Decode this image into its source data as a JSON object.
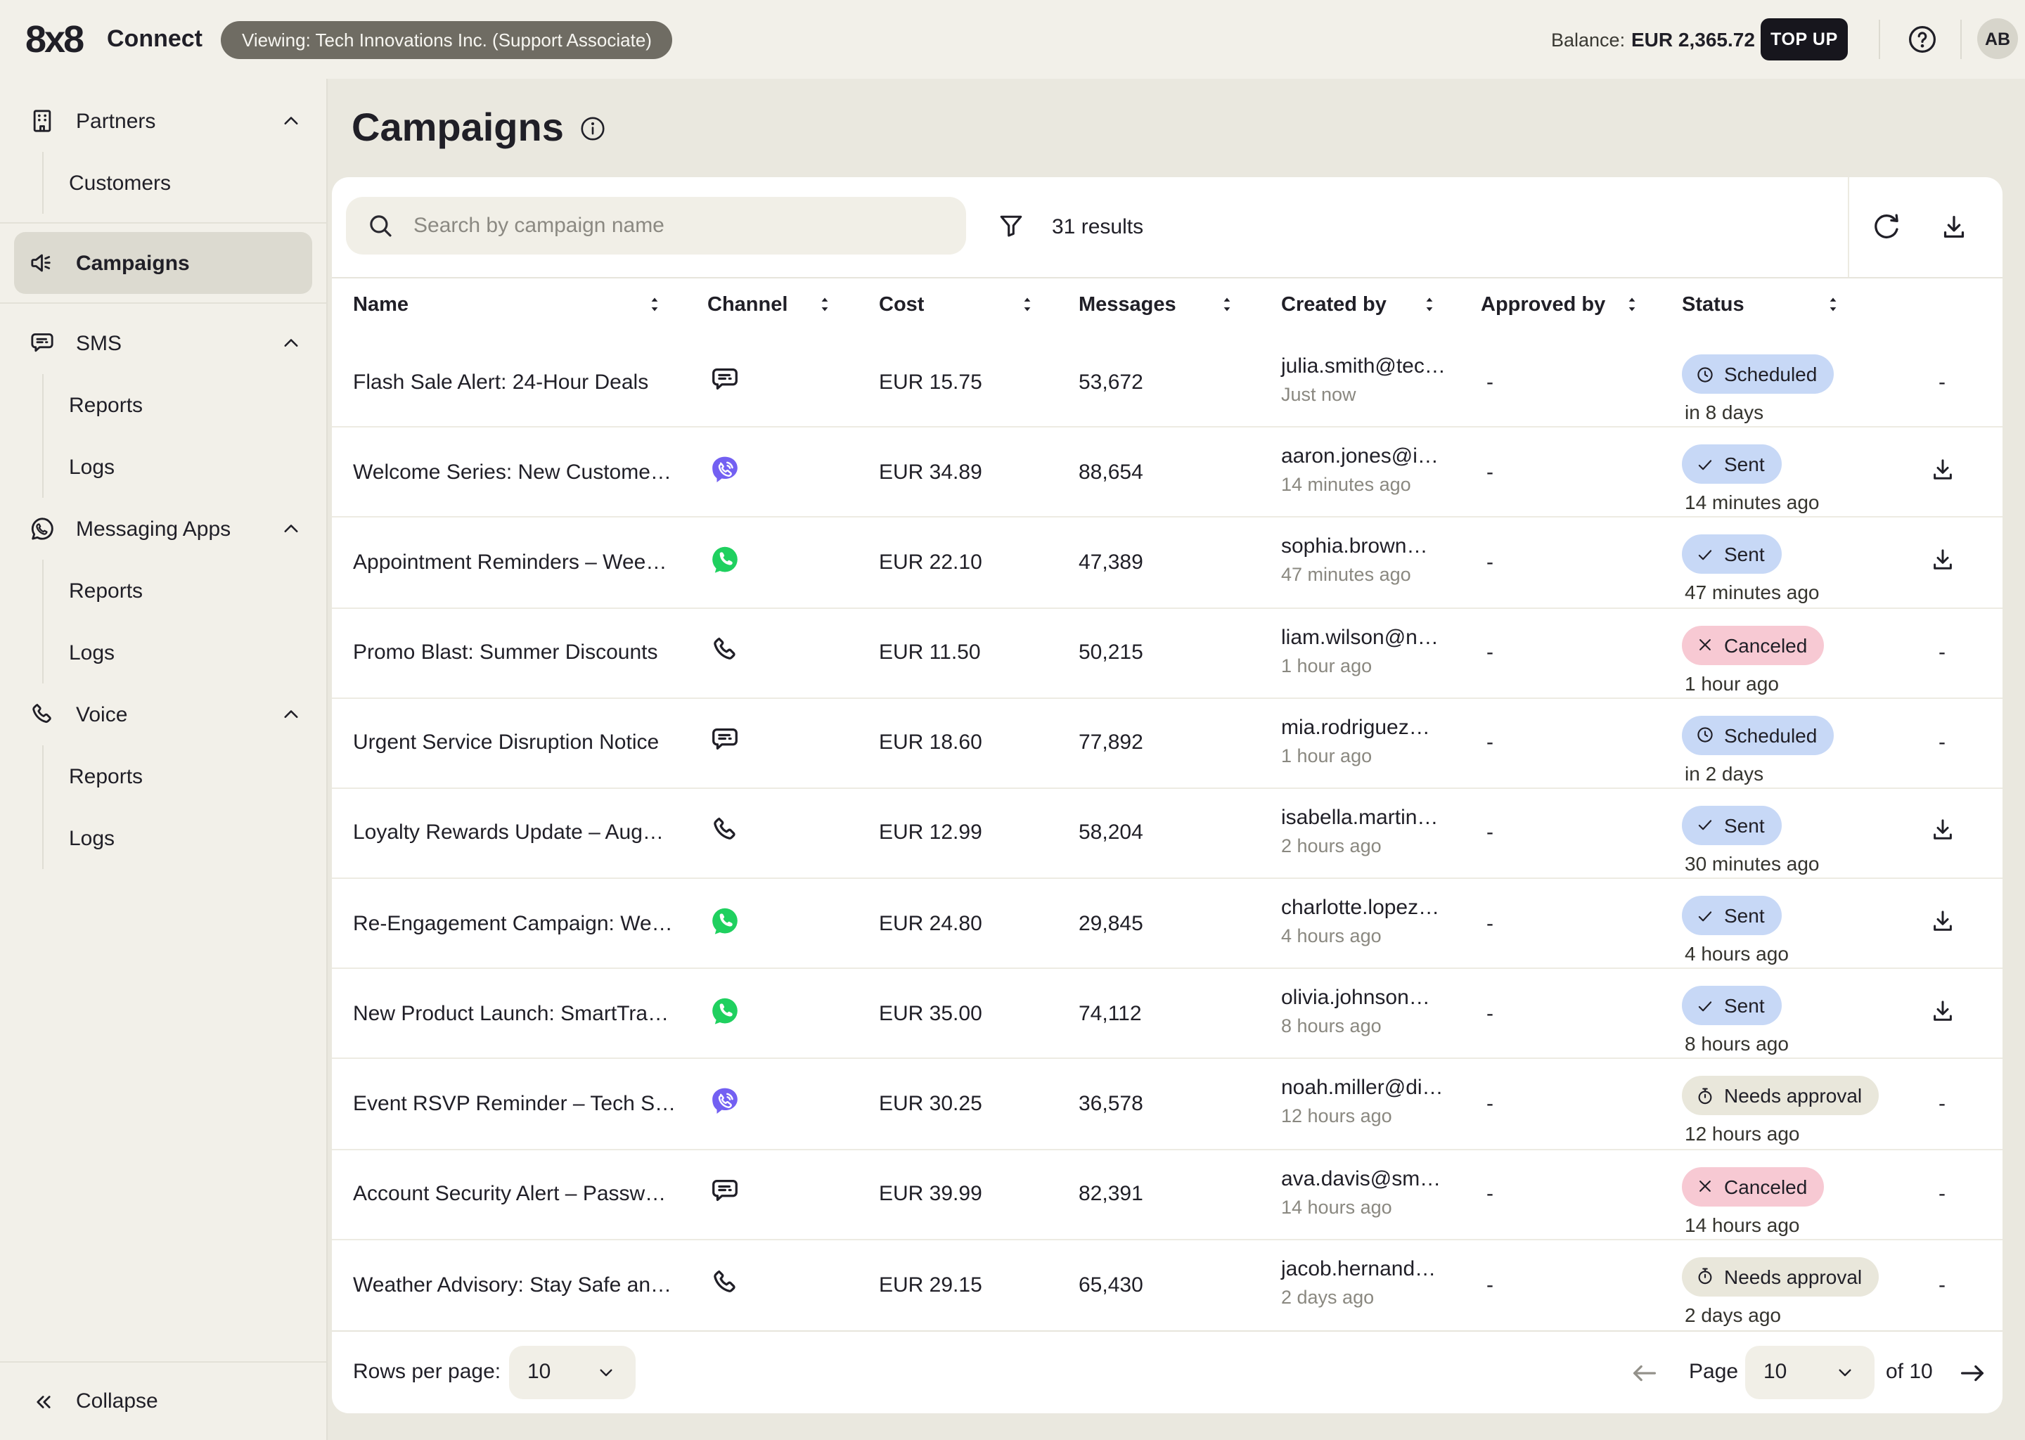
{
  "topbar": {
    "logo": "8x8",
    "product": "Connect",
    "viewing": "Viewing: Tech Innovations Inc. (Support Associate)",
    "balance_label": "Balance:",
    "balance_value": "EUR 2,365.72",
    "topup_label": "TOP UP",
    "avatar": "AB"
  },
  "sidebar": {
    "sections": [
      {
        "label": "Partners",
        "icon": "building",
        "chevron": "up",
        "active": false,
        "children": [
          "Customers"
        ]
      },
      {
        "label": "Campaigns",
        "icon": "megaphone",
        "chevron": null,
        "active": true,
        "children": []
      },
      {
        "label": "SMS",
        "icon": "chat-bubble",
        "chevron": "up",
        "active": false,
        "children": [
          "Reports",
          "Logs"
        ]
      },
      {
        "label": "Messaging Apps",
        "icon": "whatsapp-outline",
        "chevron": "up",
        "active": false,
        "children": [
          "Reports",
          "Logs"
        ]
      },
      {
        "label": "Voice",
        "icon": "phone",
        "chevron": "up",
        "active": false,
        "children": [
          "Reports",
          "Logs"
        ]
      }
    ],
    "collapse_label": "Collapse"
  },
  "page": {
    "title": "Campaigns"
  },
  "toolbar": {
    "search_placeholder": "Search by campaign name",
    "results": "31 results"
  },
  "table": {
    "columns": [
      {
        "label": "Name"
      },
      {
        "label": "Channel"
      },
      {
        "label": "Cost"
      },
      {
        "label": "Messages"
      },
      {
        "label": "Created by"
      },
      {
        "label": "Approved by"
      },
      {
        "label": "Status"
      }
    ],
    "rows": [
      {
        "name": "Flash Sale Alert: 24-Hour Deals",
        "channel": "sms",
        "cost": "EUR 15.75",
        "messages": "53,672",
        "created_by": "julia.smith@tec…",
        "created_at": "Just now",
        "approved_by": "-",
        "status": "scheduled",
        "status_detail": "in 8 days",
        "action": "none"
      },
      {
        "name": "Welcome Series: New Custome…",
        "channel": "viber",
        "cost": "EUR 34.89",
        "messages": "88,654",
        "created_by": "aaron.jones@i…",
        "created_at": "14 minutes ago",
        "approved_by": "-",
        "status": "sent",
        "status_detail": "14 minutes ago",
        "action": "download"
      },
      {
        "name": "Appointment Reminders – Wee…",
        "channel": "whatsapp",
        "cost": "EUR 22.10",
        "messages": "47,389",
        "created_by": "sophia.brown…",
        "created_at": "47 minutes ago",
        "approved_by": "-",
        "status": "sent",
        "status_detail": "47 minutes ago",
        "action": "download"
      },
      {
        "name": "Promo Blast: Summer Discounts",
        "channel": "voice",
        "cost": "EUR 11.50",
        "messages": "50,215",
        "created_by": "liam.wilson@n…",
        "created_at": "1 hour ago",
        "approved_by": "-",
        "status": "canceled",
        "status_detail": "1 hour ago",
        "action": "none"
      },
      {
        "name": "Urgent Service Disruption Notice",
        "channel": "sms",
        "cost": "EUR 18.60",
        "messages": "77,892",
        "created_by": "mia.rodriguez…",
        "created_at": "1 hour ago",
        "approved_by": "-",
        "status": "scheduled",
        "status_detail": "in 2 days",
        "action": "none"
      },
      {
        "name": "Loyalty Rewards Update – Aug…",
        "channel": "voice",
        "cost": "EUR 12.99",
        "messages": "58,204",
        "created_by": "isabella.martin…",
        "created_at": "2 hours ago",
        "approved_by": "-",
        "status": "sent",
        "status_detail": "30 minutes ago",
        "action": "download"
      },
      {
        "name": "Re-Engagement Campaign: We…",
        "channel": "whatsapp",
        "cost": "EUR 24.80",
        "messages": "29,845",
        "created_by": "charlotte.lopez…",
        "created_at": "4 hours ago",
        "approved_by": "-",
        "status": "sent",
        "status_detail": "4 hours ago",
        "action": "download"
      },
      {
        "name": "New Product Launch: SmartTra…",
        "channel": "whatsapp",
        "cost": "EUR 35.00",
        "messages": "74,112",
        "created_by": "olivia.johnson…",
        "created_at": "8 hours ago",
        "approved_by": "-",
        "status": "sent",
        "status_detail": "8 hours ago",
        "action": "download"
      },
      {
        "name": "Event RSVP Reminder – Tech S…",
        "channel": "viber",
        "cost": "EUR 30.25",
        "messages": "36,578",
        "created_by": "noah.miller@di…",
        "created_at": "12 hours ago",
        "approved_by": "-",
        "status": "needs_approval",
        "status_detail": "12 hours ago",
        "action": "none"
      },
      {
        "name": "Account Security Alert – Passw…",
        "channel": "sms",
        "cost": "EUR 39.99",
        "messages": "82,391",
        "created_by": "ava.davis@sm…",
        "created_at": "14 hours ago",
        "approved_by": "-",
        "status": "canceled",
        "status_detail": "14 hours ago",
        "action": "none"
      },
      {
        "name": "Weather Advisory: Stay Safe an…",
        "channel": "voice",
        "cost": "EUR 29.15",
        "messages": "65,430",
        "created_by": "jacob.hernand…",
        "created_at": "2 days ago",
        "approved_by": "-",
        "status": "needs_approval",
        "status_detail": "2 days ago",
        "action": "none"
      }
    ]
  },
  "statuses": {
    "scheduled": {
      "label": "Scheduled",
      "icon": "clock",
      "color": "blue"
    },
    "sent": {
      "label": "Sent",
      "icon": "check",
      "color": "blue"
    },
    "canceled": {
      "label": "Canceled",
      "icon": "x",
      "color": "pink"
    },
    "needs_approval": {
      "label": "Needs approval",
      "icon": "stopwatch",
      "color": "gray"
    }
  },
  "colors": {
    "accent_dark": "#17161d",
    "badge_blue": "#c7d8f6",
    "badge_pink": "#f7c9d3",
    "badge_gray": "#e9e7db",
    "viber_purple": "#7360f2",
    "whatsapp_green": "#1fd05f"
  },
  "footer": {
    "rows_label": "Rows per page:",
    "rows_value": "10",
    "page_label": "Page",
    "page_value": "10",
    "of_label": "of 10"
  }
}
